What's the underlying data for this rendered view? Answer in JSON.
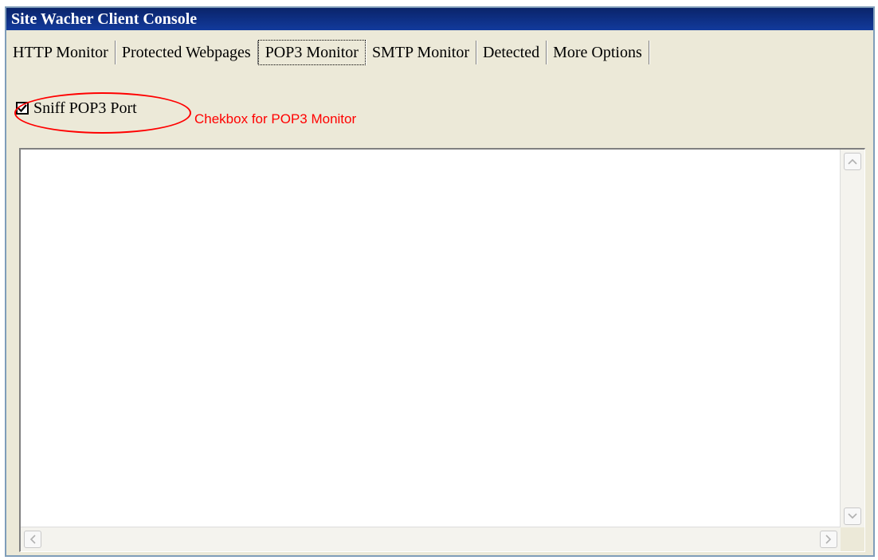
{
  "window": {
    "title": "Site Wacher Client Console"
  },
  "tabs": [
    {
      "label": "HTTP Monitor"
    },
    {
      "label": "Protected Webpages"
    },
    {
      "label": "POP3 Monitor",
      "active": true
    },
    {
      "label": "SMTP Monitor"
    },
    {
      "label": "Detected"
    },
    {
      "label": "More Options"
    }
  ],
  "pop3": {
    "checkbox_label": "Sniff POP3 Port",
    "checked": true
  },
  "annotation": {
    "text": "Chekbox for POP3 Monitor",
    "color": "#ff0000"
  },
  "icons": {
    "check": "check-icon",
    "scroll_up": "chevron-up-icon",
    "scroll_down": "chevron-down-icon",
    "scroll_left": "chevron-left-icon",
    "scroll_right": "chevron-right-icon"
  }
}
